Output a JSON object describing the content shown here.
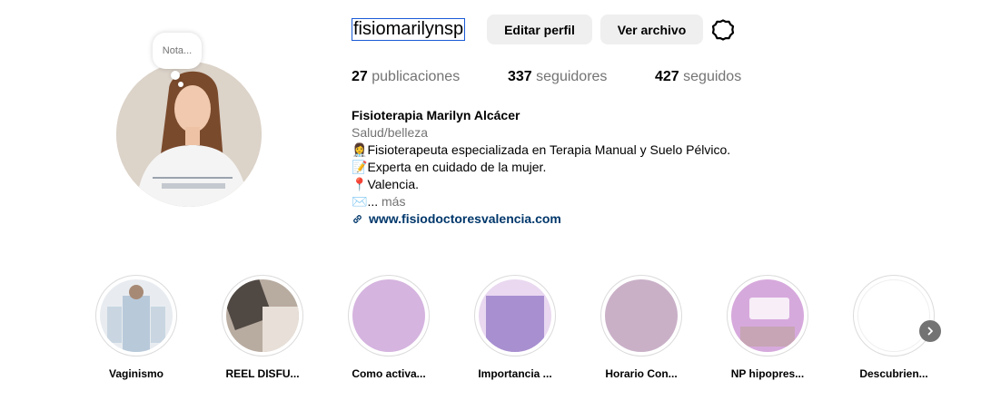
{
  "profile": {
    "username": "fisiomarilynsp",
    "note_placeholder": "Nota...",
    "edit_profile_label": "Editar perfil",
    "view_archive_label": "Ver archivo"
  },
  "stats": {
    "posts_count": "27",
    "posts_label": "publicaciones",
    "followers_count": "337",
    "followers_label": "seguidores",
    "following_count": "427",
    "following_label": "seguidos"
  },
  "bio": {
    "full_name": "Fisioterapia Marilyn Alcácer",
    "category": "Salud/belleza",
    "lines": [
      {
        "emoji": "👩‍⚕️",
        "text": "Fisioterapeuta especializada en Terapia Manual y Suelo Pélvico."
      },
      {
        "emoji": "📝",
        "text": "Experta en cuidado de la mujer."
      },
      {
        "emoji": "📍",
        "text": "Valencia."
      },
      {
        "emoji": "✉️",
        "text": "..."
      }
    ],
    "more_label": "más",
    "website": "www.fisiodoctoresvalencia.com"
  },
  "highlights": [
    {
      "label": "Vaginismo",
      "color": "#cfd8e2"
    },
    {
      "label": "REEL DISFU...",
      "color": "#8c7f76"
    },
    {
      "label": "Como activa...",
      "color": "#d5b4df"
    },
    {
      "label": "Importancia ...",
      "color": "#a88fd0"
    },
    {
      "label": "Horario Con...",
      "color": "#c9b0c7"
    },
    {
      "label": "NP hipopres...",
      "color": "#d6a9dc"
    },
    {
      "label": "Descubrien...",
      "color": "#ffffff"
    }
  ],
  "icons": {
    "settings": "gear-icon",
    "link": "link-icon",
    "next": "chevron-right-icon"
  }
}
